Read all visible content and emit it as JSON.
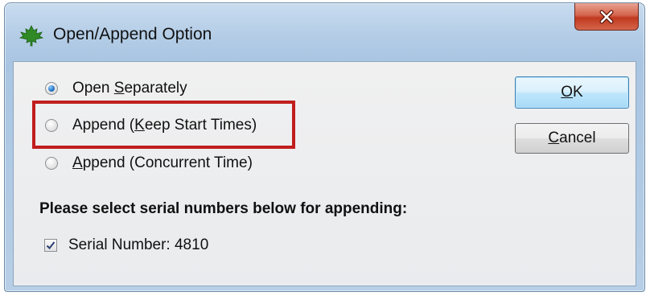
{
  "dialog": {
    "title": "Open/Append Option",
    "icon": "maple-leaf-icon",
    "close_icon": "close-icon"
  },
  "options": [
    {
      "pre": "Open ",
      "mnemonic": "S",
      "post": "eparately",
      "selected": true
    },
    {
      "pre": "Append (",
      "mnemonic": "K",
      "post": "eep Start Times)",
      "selected": false
    },
    {
      "pre": "",
      "mnemonic": "A",
      "post": "ppend (Concurrent Time)",
      "selected": false
    }
  ],
  "buttons": {
    "ok": {
      "mnemonic": "O",
      "post": "K"
    },
    "cancel": {
      "mnemonic": "C",
      "post": "ancel"
    }
  },
  "serial_section": {
    "heading": "Please select serial numbers below for appending:",
    "items": [
      {
        "label": "Serial Number: 4810",
        "checked": true
      }
    ]
  },
  "colors": {
    "highlight_border": "#c11d1d",
    "radio_selected": "#2a78c5",
    "close_button": "#c0391f"
  }
}
